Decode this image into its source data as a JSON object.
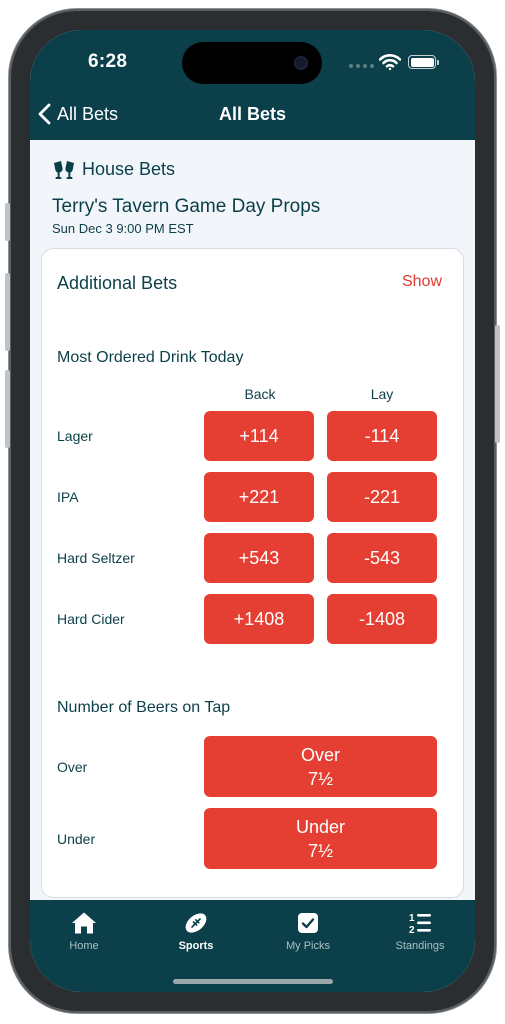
{
  "status": {
    "time": "6:28"
  },
  "nav": {
    "back_label": "All Bets",
    "title": "All Bets"
  },
  "event": {
    "category": "House Bets",
    "title": "Terry's Tavern Game Day Props",
    "date": "Sun Dec 3 9:00 PM EST"
  },
  "card": {
    "title": "Additional Bets",
    "show_label": "Show",
    "drink_section": {
      "title": "Most Ordered Drink Today",
      "col_back": "Back",
      "col_lay": "Lay",
      "rows": [
        {
          "label": "Lager",
          "back": "+114",
          "lay": "-114"
        },
        {
          "label": "IPA",
          "back": "+221",
          "lay": "-221"
        },
        {
          "label": "Hard Seltzer",
          "back": "+543",
          "lay": "-543"
        },
        {
          "label": "Hard Cider",
          "back": "+1408",
          "lay": "-1408"
        }
      ]
    },
    "beers_section": {
      "title": "Number of Beers on Tap",
      "rows": [
        {
          "label": "Over",
          "line1": "Over",
          "line2": "7½"
        },
        {
          "label": "Under",
          "line1": "Under",
          "line2": "7½"
        }
      ]
    }
  },
  "tabs": [
    {
      "label": "Home",
      "icon": "home-icon",
      "active": false
    },
    {
      "label": "Sports",
      "icon": "football-icon",
      "active": true
    },
    {
      "label": "My Picks",
      "icon": "checkbox-icon",
      "active": false
    },
    {
      "label": "Standings",
      "icon": "ranked-list-icon",
      "active": false
    }
  ],
  "colors": {
    "header": "#0b3f49",
    "accent": "#e53f33",
    "background": "#f2f5fa"
  }
}
